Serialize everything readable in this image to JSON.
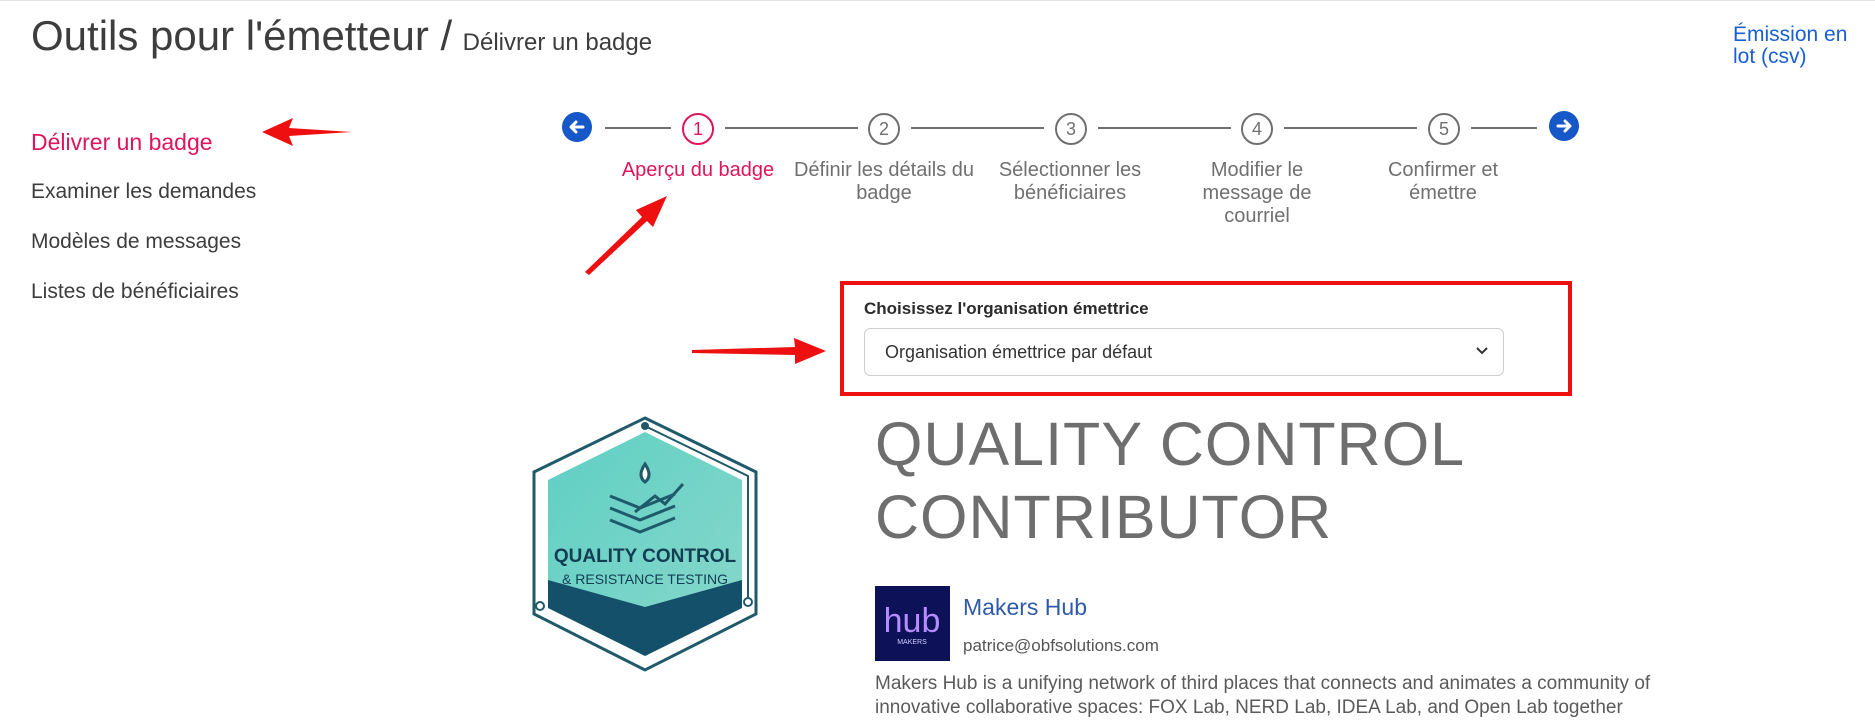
{
  "header": {
    "title": "Outils pour l'émetteur /",
    "subtitle": "Délivrer un badge",
    "bulk_link": "Émission en lot (csv)"
  },
  "sidebar": {
    "items": [
      {
        "label": "Délivrer un badge",
        "active": true
      },
      {
        "label": "Examiner les demandes"
      },
      {
        "label": "Modèles de messages"
      },
      {
        "label": "Listes de bénéficiaires"
      }
    ]
  },
  "stepper": {
    "prev_icon": "arrow-left-icon",
    "next_icon": "arrow-right-icon",
    "steps": [
      {
        "number": "1",
        "label": "Aperçu du badge",
        "active": true
      },
      {
        "number": "2",
        "label": "Définir les détails du badge"
      },
      {
        "number": "3",
        "label": "Sélectionner les bénéficiaires"
      },
      {
        "number": "4",
        "label": "Modifier le message de courriel"
      },
      {
        "number": "5",
        "label": "Confirmer et émettre"
      }
    ]
  },
  "org_select": {
    "label": "Choisissez l'organisation émettrice",
    "value": "Organisation émettrice par défaut"
  },
  "badge": {
    "image_text_line1": "QUALITY CONTROL",
    "image_text_line2": "& RESISTANCE TESTING",
    "title_line1": "QUALITY CONTROL",
    "title_line2": "CONTRIBUTOR"
  },
  "issuer": {
    "logo_text": "hub",
    "logo_subtext": "MAKERS",
    "name": "Makers Hub",
    "email": "patrice@obfsolutions.com",
    "description": "Makers Hub is a unifying network of third places that connects and animates a community of innovative collaborative spaces: FOX Lab, NERD Lab, IDEA Lab, and Open Lab together"
  },
  "colors": {
    "accent": "#e0145c",
    "link": "#1a5fd1",
    "nav_circle": "#1758c9",
    "annotation_red": "#ee1010"
  }
}
